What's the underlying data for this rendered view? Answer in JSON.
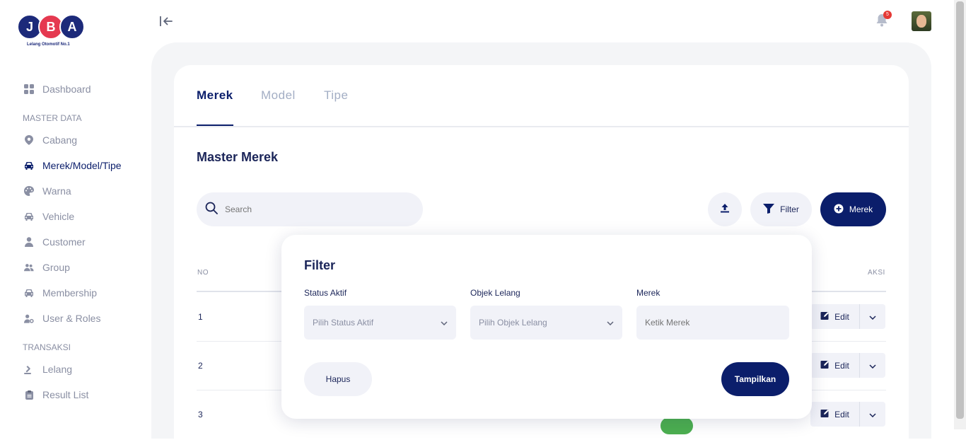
{
  "brand": {
    "letters": [
      "J",
      "B",
      "A"
    ],
    "tagline": "Lelang Otomotif No.1",
    "colors": [
      "#1c2a7a",
      "#e53950",
      "#1c2a7a"
    ]
  },
  "sidebar": {
    "dashboard": {
      "label": "Dashboard",
      "icon": "grid-icon"
    },
    "section_master": "MASTER DATA",
    "master_items": [
      {
        "label": "Cabang",
        "icon": "location-pin-icon"
      },
      {
        "label": "Merek/Model/Tipe",
        "icon": "car-icon",
        "active": true
      },
      {
        "label": "Warna",
        "icon": "palette-icon"
      },
      {
        "label": "Vehicle",
        "icon": "car-icon"
      },
      {
        "label": "Customer",
        "icon": "user-icon"
      },
      {
        "label": "Group",
        "icon": "users-icon"
      },
      {
        "label": "Membership",
        "icon": "car-icon"
      },
      {
        "label": "User & Roles",
        "icon": "user-cog-icon"
      }
    ],
    "section_transaksi": "TRANSAKSI",
    "transaksi_items": [
      {
        "label": "Lelang",
        "icon": "gavel-icon"
      },
      {
        "label": "Result List",
        "icon": "clipboard-icon"
      }
    ]
  },
  "topbar": {
    "notification_count": "5"
  },
  "tabs": [
    {
      "label": "Merek",
      "active": true
    },
    {
      "label": "Model",
      "active": false
    },
    {
      "label": "Tipe",
      "active": false
    }
  ],
  "page_title": "Master Merek",
  "search": {
    "placeholder": "Search"
  },
  "toolbar": {
    "filter_label": "Filter",
    "add_label": "Merek"
  },
  "table": {
    "columns": {
      "no": "NO",
      "aksi": "AKSI"
    },
    "rows": [
      {
        "no": "1",
        "action": "Edit"
      },
      {
        "no": "2",
        "action": "Edit"
      },
      {
        "no": "3",
        "action": "Edit"
      }
    ]
  },
  "filter_popup": {
    "title": "Filter",
    "fields": [
      {
        "label": "Status Aktif",
        "placeholder": "Pilih Status Aktif"
      },
      {
        "label": "Objek Lelang",
        "placeholder": "Pilih Objek Lelang"
      },
      {
        "label": "Merek",
        "placeholder": "Ketik Merek"
      }
    ],
    "reset_label": "Hapus",
    "apply_label": "Tampilkan"
  },
  "colors": {
    "primary": "#0b1e6b",
    "muted": "#8a8fa3",
    "surface": "#f1f2f8",
    "toggle_on": "#4caf50",
    "badge": "#e53935"
  }
}
